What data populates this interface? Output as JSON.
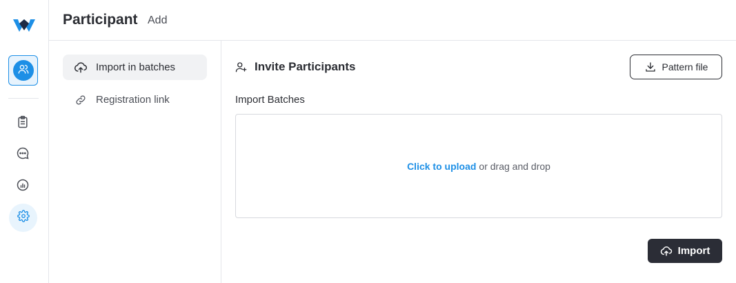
{
  "header": {
    "title": "Participant",
    "subtitle": "Add"
  },
  "rail": {
    "items": [
      {
        "icon": "participants-icon",
        "active": true
      },
      {
        "icon": "clipboard-icon"
      },
      {
        "icon": "chat-icon"
      },
      {
        "icon": "analytics-icon"
      },
      {
        "icon": "settings-icon"
      }
    ],
    "accent": "#1d8fe6"
  },
  "subnav": {
    "items": [
      {
        "label": "Import in batches",
        "icon": "upload-cloud-icon"
      },
      {
        "label": "Registration link",
        "icon": "link-icon"
      }
    ]
  },
  "main": {
    "section_title": "Invite Participants",
    "pattern_button": "Pattern file",
    "field_label": "Import Batches",
    "dropzone": {
      "link_text": "Click to upload",
      "rest_text": "or drag and drop"
    },
    "import_button": "Import"
  }
}
